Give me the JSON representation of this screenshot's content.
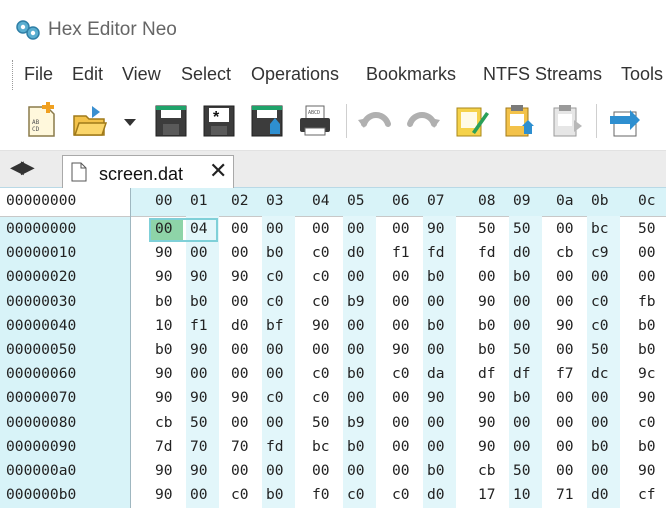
{
  "window": {
    "title": "Hex Editor Neo",
    "app_icon": "hex-editor-neo-logo-icon"
  },
  "menu": {
    "items": [
      "File",
      "Edit",
      "View",
      "Select",
      "Operations",
      "Bookmarks",
      "NTFS Streams",
      "Tools"
    ]
  },
  "toolbar": {
    "buttons": [
      "new-file-icon",
      "open-file-icon",
      "open-dropdown-arrow-icon",
      "save-icon",
      "save-all-icon",
      "save-as-icon",
      "print-icon",
      "undo-icon",
      "redo-icon",
      "edit-notepad-icon",
      "paste-icon",
      "copy-clipboard-icon",
      "export-icon"
    ]
  },
  "tabs": {
    "nav_arrows": "◀▶",
    "active": {
      "label": "screen.dat",
      "close": "✕"
    }
  },
  "hex": {
    "header_offset": "00000000",
    "columns": [
      "00",
      "01",
      "02",
      "03",
      "04",
      "05",
      "06",
      "07",
      "08",
      "09",
      "0a",
      "0b",
      "0c"
    ],
    "rows": [
      {
        "offset": "00000000",
        "bytes": [
          "00",
          "04",
          "00",
          "00",
          "00",
          "00",
          "00",
          "90",
          "50",
          "50",
          "00",
          "bc",
          "50"
        ]
      },
      {
        "offset": "00000010",
        "bytes": [
          "90",
          "00",
          "00",
          "b0",
          "c0",
          "d0",
          "f1",
          "fd",
          "fd",
          "d0",
          "cb",
          "c9",
          "00"
        ]
      },
      {
        "offset": "00000020",
        "bytes": [
          "90",
          "90",
          "90",
          "c0",
          "c0",
          "00",
          "00",
          "b0",
          "00",
          "b0",
          "00",
          "00",
          "00"
        ]
      },
      {
        "offset": "00000030",
        "bytes": [
          "b0",
          "b0",
          "00",
          "c0",
          "c0",
          "b9",
          "00",
          "00",
          "90",
          "00",
          "00",
          "c0",
          "fb"
        ]
      },
      {
        "offset": "00000040",
        "bytes": [
          "10",
          "f1",
          "d0",
          "bf",
          "90",
          "00",
          "00",
          "b0",
          "b0",
          "00",
          "90",
          "c0",
          "b0"
        ]
      },
      {
        "offset": "00000050",
        "bytes": [
          "b0",
          "90",
          "00",
          "00",
          "00",
          "00",
          "90",
          "00",
          "b0",
          "50",
          "00",
          "50",
          "b0"
        ]
      },
      {
        "offset": "00000060",
        "bytes": [
          "90",
          "00",
          "00",
          "00",
          "c0",
          "b0",
          "c0",
          "da",
          "df",
          "df",
          "f7",
          "dc",
          "9c"
        ]
      },
      {
        "offset": "00000070",
        "bytes": [
          "90",
          "90",
          "90",
          "c0",
          "c0",
          "00",
          "00",
          "90",
          "90",
          "b0",
          "00",
          "00",
          "90"
        ]
      },
      {
        "offset": "00000080",
        "bytes": [
          "cb",
          "50",
          "00",
          "00",
          "50",
          "b9",
          "00",
          "00",
          "90",
          "00",
          "00",
          "00",
          "c0"
        ]
      },
      {
        "offset": "00000090",
        "bytes": [
          "7d",
          "70",
          "70",
          "fd",
          "bc",
          "b0",
          "00",
          "00",
          "90",
          "00",
          "00",
          "b0",
          "b0"
        ]
      },
      {
        "offset": "000000a0",
        "bytes": [
          "90",
          "90",
          "00",
          "00",
          "00",
          "00",
          "00",
          "b0",
          "cb",
          "50",
          "00",
          "00",
          "90"
        ]
      },
      {
        "offset": "000000b0",
        "bytes": [
          "90",
          "00",
          "c0",
          "b0",
          "f0",
          "c0",
          "c0",
          "d0",
          "17",
          "10",
          "71",
          "d0",
          "cf"
        ]
      }
    ]
  }
}
